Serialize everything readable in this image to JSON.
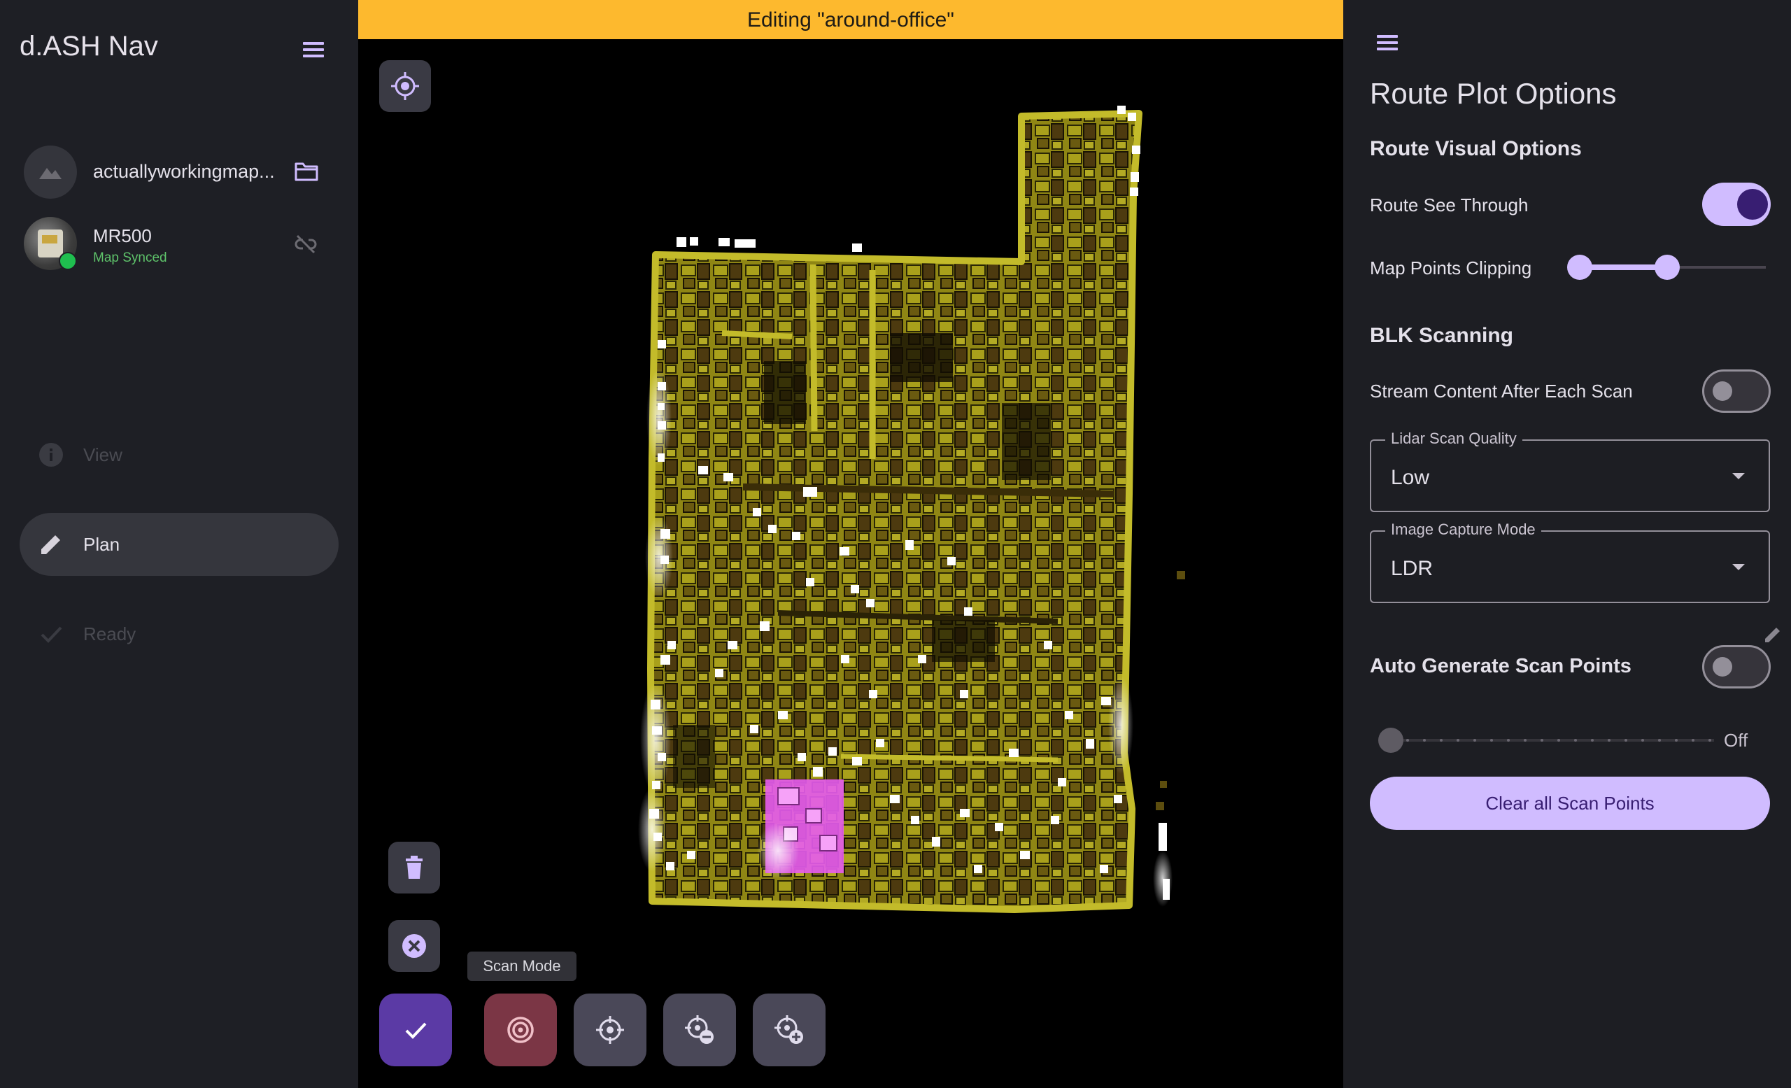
{
  "sidebar": {
    "app_title": "d.ASH Nav",
    "map_name": "actuallyworkingmap...",
    "robot": {
      "name": "MR500",
      "status": "Map Synced",
      "status_color": "#1fbe4f"
    },
    "nav": [
      {
        "label": "View",
        "icon": "info-icon",
        "enabled": false
      },
      {
        "label": "Plan",
        "icon": "pencil-icon",
        "enabled": true,
        "selected": true
      },
      {
        "label": "Ready",
        "icon": "check-icon",
        "enabled": false
      }
    ]
  },
  "map": {
    "banner": "Editing \"around-office\"",
    "banner_color": "#fdb92e",
    "tooltip": "Scan Mode",
    "tools": [
      "locate-icon",
      "trash-icon",
      "cancel-icon",
      "check-icon",
      "scan-mode-icon",
      "target-icon",
      "target-remove-icon",
      "target-add-icon"
    ]
  },
  "panel": {
    "title": "Route Plot Options",
    "visual_heading": "Route Visual Options",
    "see_through_label": "Route See Through",
    "see_through_on": true,
    "clipping_label": "Map Points Clipping",
    "blk_heading": "BLK Scanning",
    "stream_label": "Stream Content After Each Scan",
    "stream_on": false,
    "lidar": {
      "label": "Lidar Scan Quality",
      "value": "Low"
    },
    "capture": {
      "label": "Image Capture Mode",
      "value": "LDR"
    },
    "auto_label": "Auto Generate Scan Points",
    "auto_on": false,
    "auto_value": "Off",
    "clear_label": "Clear all Scan Points",
    "accent": "#d0bcff"
  }
}
